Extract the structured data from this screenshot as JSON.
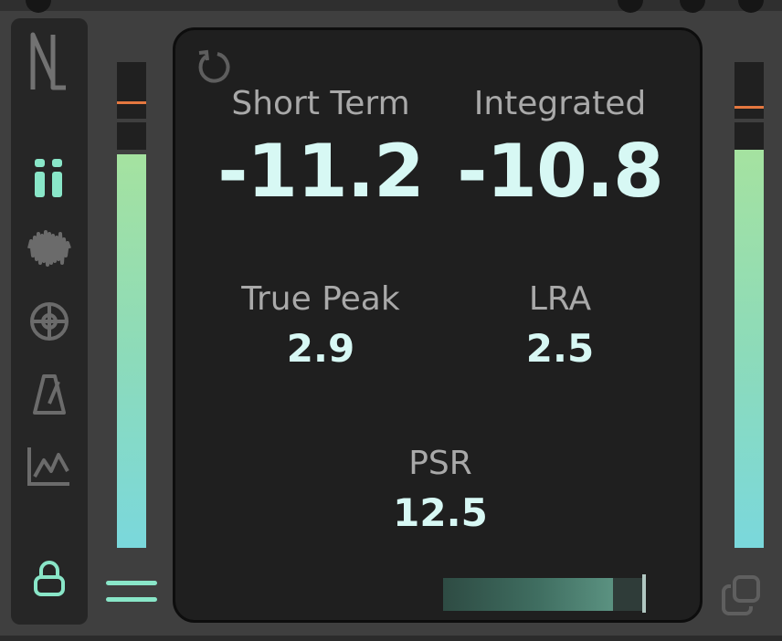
{
  "panel": {
    "short_term": {
      "label": "Short Term",
      "value": "-11.2"
    },
    "integrated": {
      "label": "Integrated",
      "value": "-10.8"
    },
    "true_peak": {
      "label": "True Peak",
      "value": "2.9"
    },
    "lra": {
      "label": "LRA",
      "value": "2.5"
    },
    "psr": {
      "label": "PSR",
      "value": "12.5"
    }
  },
  "sidebar": {
    "items": [
      {
        "icon": "logo-icon",
        "active": false
      },
      {
        "icon": "meter-view-icon",
        "active": true
      },
      {
        "icon": "waveform-icon",
        "active": false
      },
      {
        "icon": "target-icon",
        "active": false
      },
      {
        "icon": "metronome-icon",
        "active": false
      },
      {
        "icon": "graph-icon",
        "active": false
      },
      {
        "icon": "lock-icon",
        "active": true
      }
    ]
  },
  "meters": {
    "left": {
      "level": 0.81,
      "marker_level": 0.92
    },
    "right": {
      "level": 0.82,
      "marker_level": 0.91
    }
  },
  "range_slider": {
    "fill": 0.84,
    "position": 0.98
  },
  "colors": {
    "accent": "#89e6c8",
    "value_text": "#d7f8f4",
    "label_text": "#a9a9a9",
    "peak_marker": "#e4773f",
    "panel_bg": "#1f1f1f",
    "sidebar_bg": "#262626"
  }
}
